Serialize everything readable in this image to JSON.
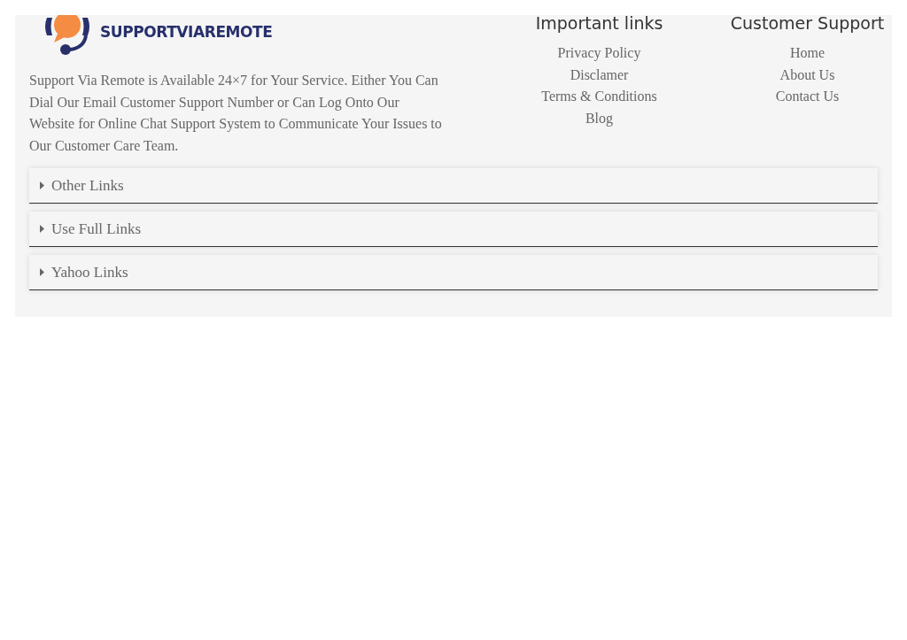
{
  "logo": {
    "text": "SUPPORTVIAREMOTE"
  },
  "about": "Support Via Remote is Available 24×7 for Your Service. Either You Can Dial Our Email Customer Support Number or Can Log Onto Our Website for Online Chat Support System to Communicate Your Issues to Our Customer Care Team.",
  "link_columns": [
    {
      "title": "Important links",
      "links": [
        "Privacy Policy",
        "Disclamer",
        "Terms & Conditions",
        "Blog"
      ]
    },
    {
      "title": "Customer Support",
      "links": [
        "Home",
        "About Us",
        "Contact Us"
      ]
    }
  ],
  "accordion": [
    {
      "label": "Other Links",
      "expanded": false
    },
    {
      "label": "Use Full Links",
      "expanded": false
    },
    {
      "label": "Yahoo Links",
      "expanded": false
    }
  ]
}
